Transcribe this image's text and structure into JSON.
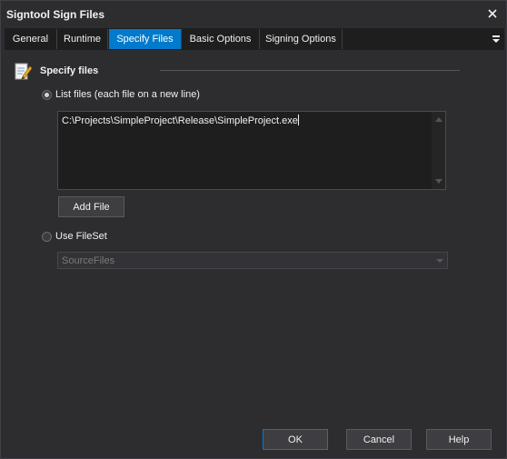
{
  "window": {
    "title": "Signtool Sign Files"
  },
  "tabs": [
    {
      "label": "General"
    },
    {
      "label": "Runtime"
    },
    {
      "label": "Specify Files"
    },
    {
      "label": "Basic Options"
    },
    {
      "label": "Signing Options"
    }
  ],
  "active_tab": "Specify Files",
  "section": {
    "title": "Specify files",
    "icon": "notepad-pencil-icon"
  },
  "options": {
    "list_files": {
      "label": "List files (each file on a new line)",
      "checked": true
    },
    "use_fileset": {
      "label": "Use FileSet",
      "checked": false
    }
  },
  "files_memo": {
    "value": "C:\\Projects\\SimpleProject\\Release\\SimpleProject.exe"
  },
  "add_file_label": "Add File",
  "fileset_select": {
    "value": "SourceFiles",
    "disabled": true
  },
  "buttons": {
    "ok": "OK",
    "cancel": "Cancel",
    "help": "Help"
  },
  "colors": {
    "accent": "#007acc",
    "background": "#2d2d30",
    "input": "#1e1e1e"
  }
}
